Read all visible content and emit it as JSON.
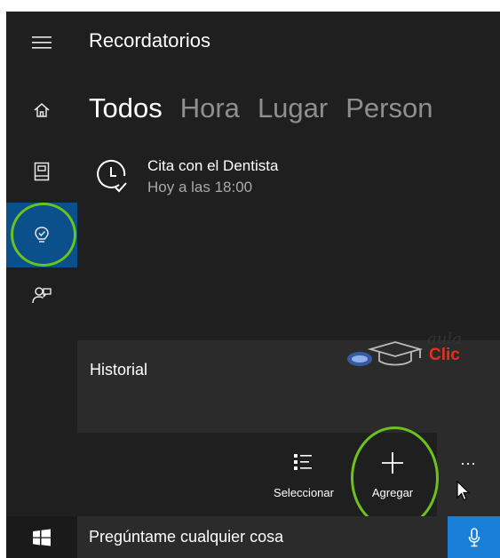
{
  "app": {
    "title": "Recordatorios"
  },
  "rail": {
    "items": [
      {
        "icon": "hamburger-menu-icon"
      },
      {
        "icon": "home-icon"
      },
      {
        "icon": "notebook-icon"
      },
      {
        "icon": "reminders-lightbulb-icon",
        "selected": true
      },
      {
        "icon": "feedback-icon"
      }
    ]
  },
  "tabs": [
    "Todos",
    "Hora",
    "Lugar",
    "Person"
  ],
  "reminder": {
    "title": "Cita con el Dentista",
    "time": "Hoy a las 18:00",
    "icon": "clock-check-icon"
  },
  "history": {
    "label": "Historial"
  },
  "watermark": {
    "line1": "aula",
    "line2": "Clic"
  },
  "commands": {
    "select_label": "Seleccionar",
    "add_label": "Agregar",
    "more_label": "..."
  },
  "taskbar": {
    "search_placeholder": "Pregúntame cualquier cosa"
  },
  "colors": {
    "background": "#1f1f1f",
    "accent": "#0b4f8b",
    "highlight_ring": "#6cc11c",
    "mic_button": "#1a7fd6"
  }
}
